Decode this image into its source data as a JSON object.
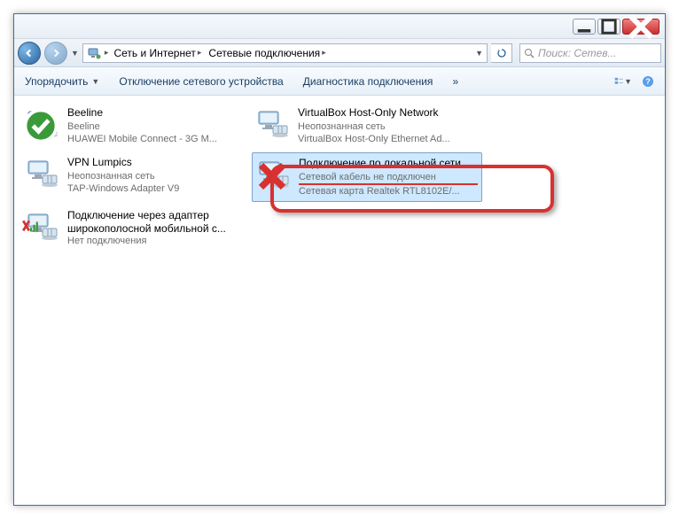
{
  "breadcrumbs": {
    "root": "Сеть и Интернет",
    "current": "Сетевые подключения"
  },
  "search": {
    "placeholder": "Поиск: Сетев..."
  },
  "toolbar": {
    "organize": "Упорядочить",
    "disable": "Отключение сетевого устройства",
    "diagnose": "Диагностика подключения",
    "more": "»"
  },
  "connections": [
    {
      "name": "Beeline",
      "status": "Beeline",
      "device": "HUAWEI Mobile Connect - 3G M...",
      "badge": "ok"
    },
    {
      "name": "VirtualBox Host-Only Network",
      "status": "Неопознанная сеть",
      "device": "VirtualBox Host-Only Ethernet Ad...",
      "badge": "none"
    },
    {
      "name": "VPN Lumpics",
      "status": "Неопознанная сеть",
      "device": "TAP-Windows Adapter V9",
      "badge": "none"
    },
    {
      "name": "Подключение по локальной сети",
      "status": "Сетевой кабель не подключен",
      "device": "Сетевая карта Realtek RTL8102E/...",
      "badge": "error",
      "selected": true
    },
    {
      "name": "Подключение через адаптер широкополосной мобильной с...",
      "status": "Нет подключения",
      "device": "",
      "badge": "signal-off",
      "multiline": true
    }
  ]
}
